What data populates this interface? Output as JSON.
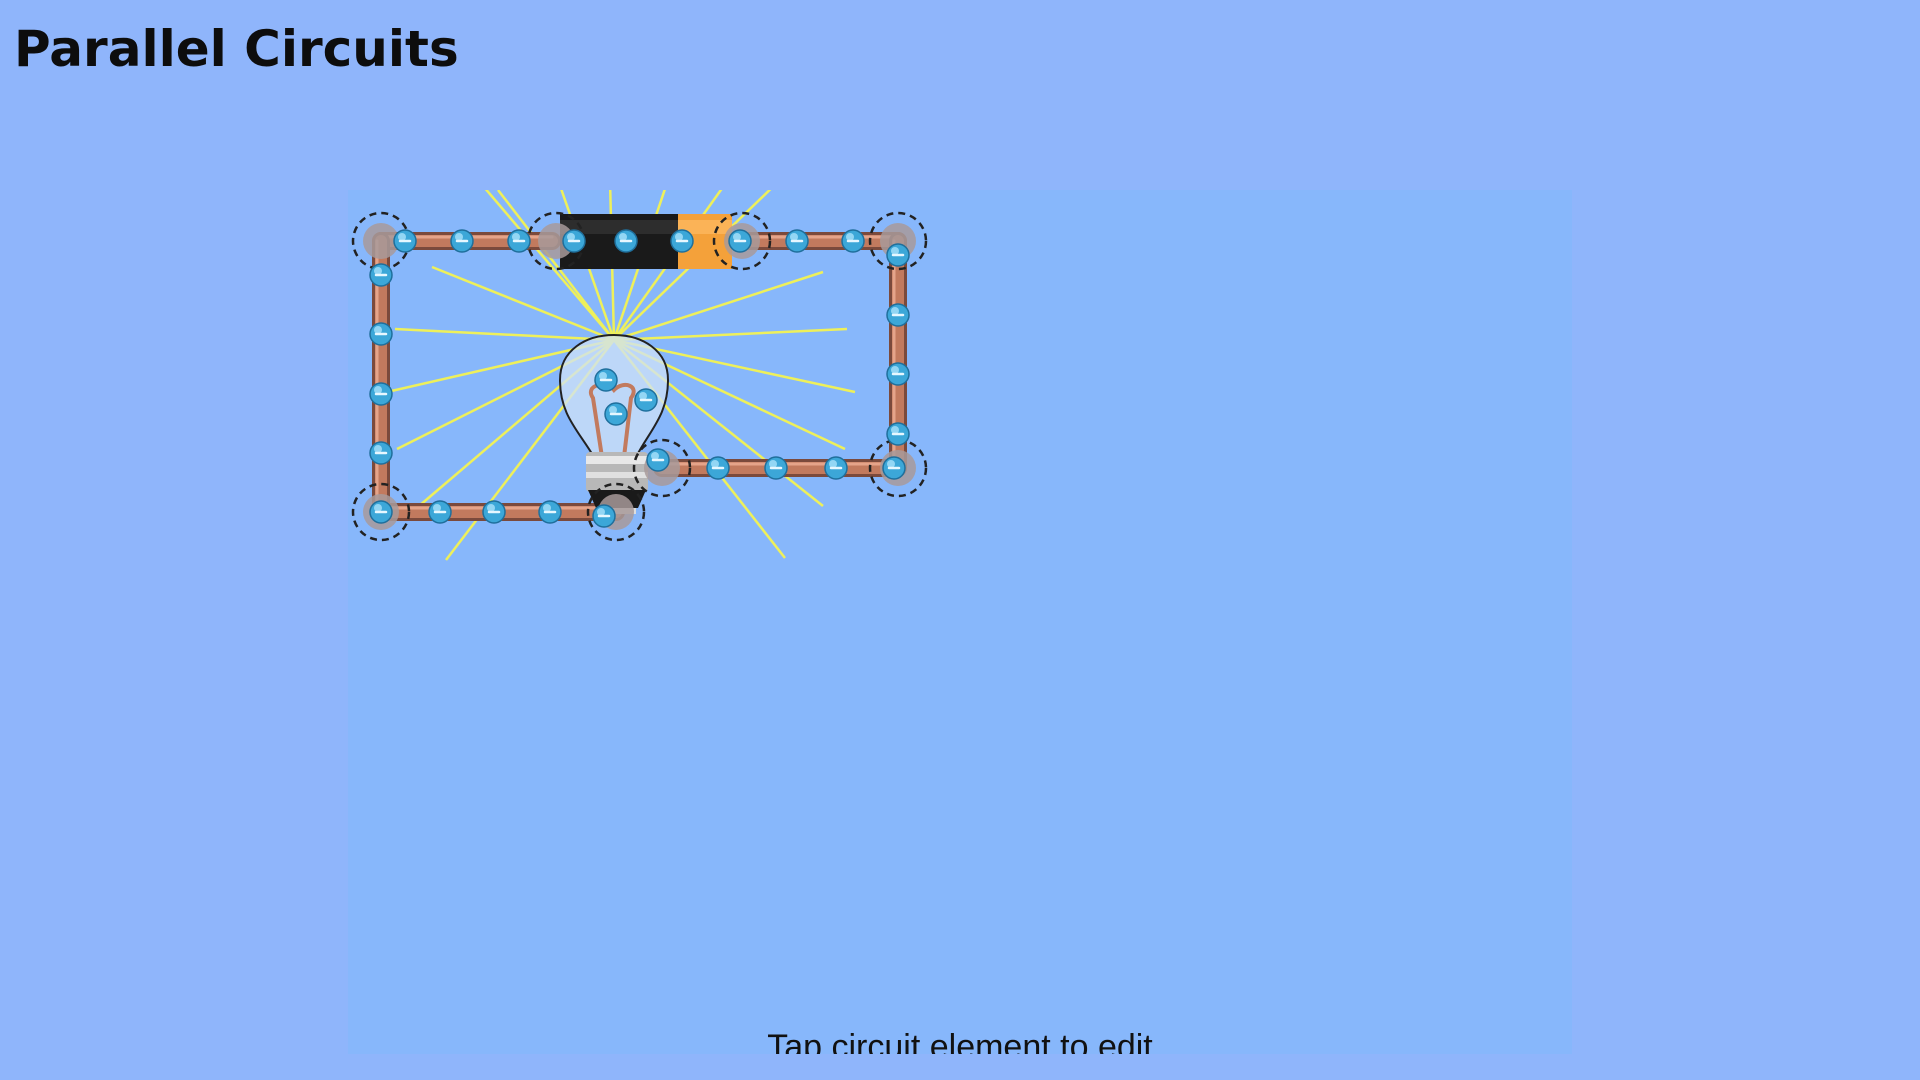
{
  "page": {
    "title": "Parallel Circuits",
    "background_color": "#8fb5fb"
  },
  "simulation": {
    "panel_color": "#87b7fb",
    "hint": "Tap circuit element to edit",
    "components": {
      "wire_color": "#c27a5e",
      "battery_body_color": "#1a1a1a",
      "battery_tip_color": "#f4a13a",
      "electron_color": "#3ca7d8",
      "light_ray_color": "#eef05a"
    }
  }
}
